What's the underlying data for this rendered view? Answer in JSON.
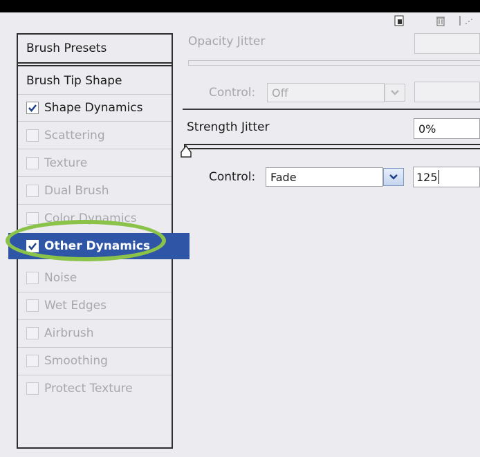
{
  "panel_sections": {
    "brush_presets": "Brush Presets",
    "brush_tip_shape": "Brush Tip Shape"
  },
  "options": [
    {
      "label": "Shape Dynamics",
      "checked": true,
      "enabled": true
    },
    {
      "label": "Scattering",
      "checked": false,
      "enabled": false
    },
    {
      "label": "Texture",
      "checked": false,
      "enabled": false
    },
    {
      "label": "Dual Brush",
      "checked": false,
      "enabled": false
    },
    {
      "label": "Color Dynamics",
      "checked": false,
      "enabled": false
    },
    {
      "label": "Other Dynamics",
      "checked": true,
      "enabled": true,
      "selected": true
    },
    {
      "label": "Noise",
      "checked": false,
      "enabled": false
    },
    {
      "label": "Wet Edges",
      "checked": false,
      "enabled": false
    },
    {
      "label": "Airbrush",
      "checked": false,
      "enabled": false
    },
    {
      "label": "Smoothing",
      "checked": false,
      "enabled": false
    },
    {
      "label": "Protect Texture",
      "checked": false,
      "enabled": false
    }
  ],
  "opacity_jitter": {
    "label": "Opacity Jitter",
    "control_label": "Control:",
    "control_value": "Off",
    "enabled": false
  },
  "strength_jitter": {
    "label": "Strength Jitter",
    "value": "0%",
    "slider_fraction": 0,
    "control_label": "Control:",
    "control_value": "Fade",
    "fade_steps": "125"
  },
  "icons": [
    "new-preset-icon",
    "trash-icon",
    "panel-grip-icon"
  ],
  "colors": {
    "selection": "#2f56a6",
    "highlight_oval": "#8bc34a",
    "panel_bg": "#ecebf0"
  }
}
